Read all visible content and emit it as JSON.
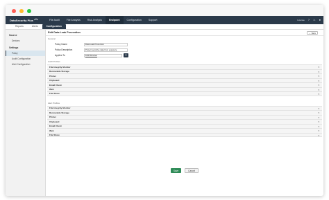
{
  "app": {
    "brand": "DataSecurity Plus"
  },
  "topnav": {
    "items": [
      "File Audit",
      "File Analysis",
      "Risk Analysis",
      "Endpoint",
      "Configuration",
      "Support"
    ],
    "active": "Endpoint",
    "license_label": "License",
    "help_icon": "?",
    "notify_icon": "bell-icon",
    "user_icon": "user-icon"
  },
  "subnav": {
    "tabs": [
      "Reports",
      "Alerts",
      "Configuration"
    ],
    "active": "Configuration"
  },
  "sidebar": {
    "groups": [
      {
        "label": "Source",
        "items": [
          "Devices"
        ]
      },
      {
        "label": "Settings",
        "items": [
          "Policy",
          "Audit Configuration",
          "Alert Configuration"
        ]
      }
    ],
    "active": "Policy"
  },
  "page": {
    "title": "Edit Data Leak Prevention",
    "back_icon": "←",
    "back_label": "Back",
    "general_label": "General",
    "fields": {
      "policy_name_label": "Policy Name",
      "policy_name_value": "Data Leak Prevention",
      "policy_desc_label": "Policy Description",
      "policy_desc_value": "Protect sensitive data from exposure",
      "applies_to_label": "Applies To",
      "applies_to_value": "1000 Devices",
      "add_label": "+"
    },
    "audit_label": "Audit Profiles",
    "audit_profiles": [
      "File Integrity Monitor",
      "Removable Storage",
      "Printer",
      "Clipboard",
      "Email Client",
      "Web",
      "File Share"
    ],
    "alert_label": "Alert Profiles",
    "alert_profiles": [
      "File Integrity Monitor",
      "Removable Storage",
      "Printer",
      "Clipboard",
      "Email Client",
      "Web",
      "File Share"
    ],
    "save_label": "Save",
    "cancel_label": "Cancel"
  },
  "colors": {
    "nav_bg": "#2b3a4a",
    "save_bg": "#2e8b57"
  }
}
